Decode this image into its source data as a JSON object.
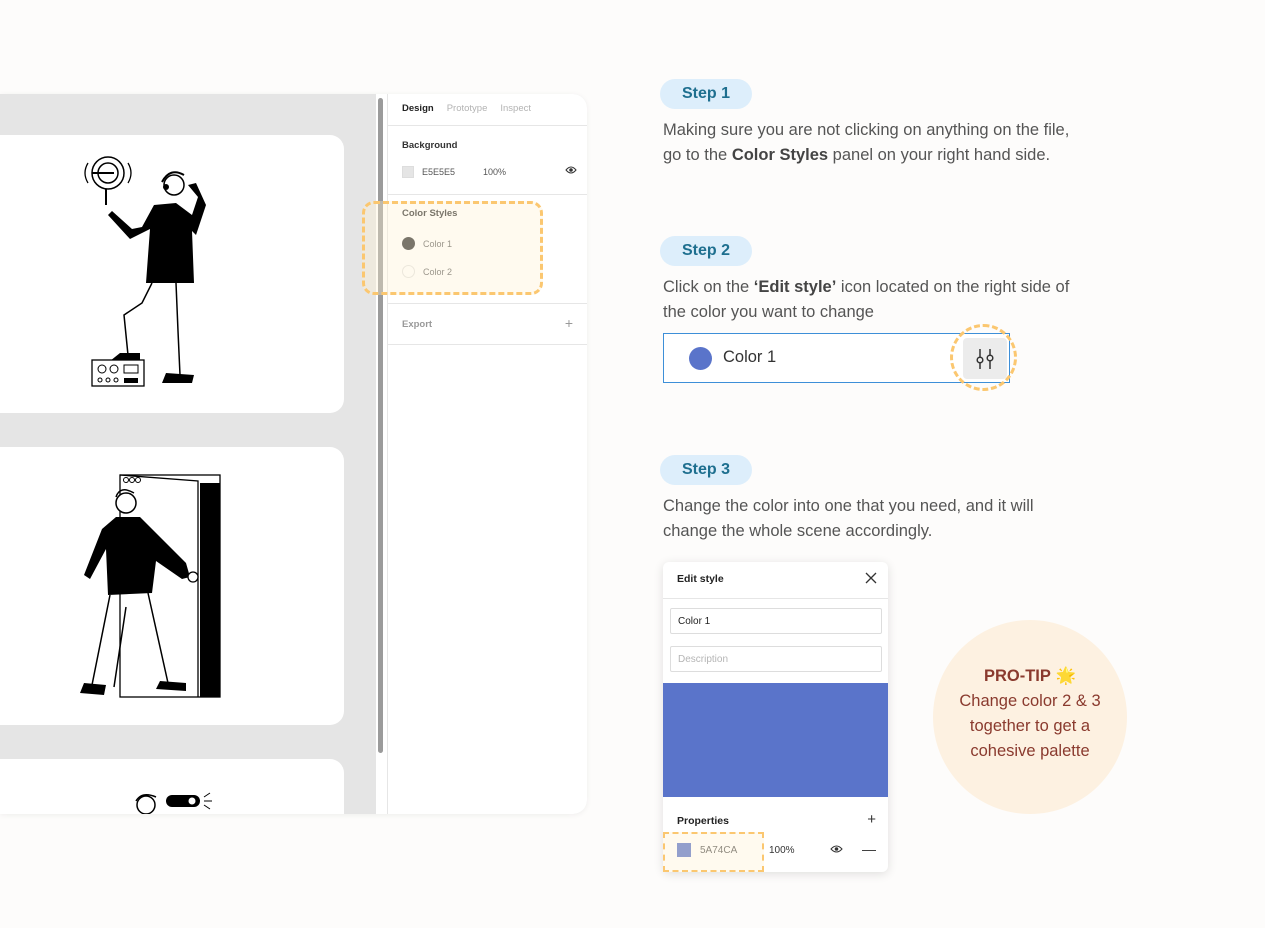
{
  "panel": {
    "tabs": [
      "Design",
      "Prototype",
      "Inspect"
    ],
    "background_title": "Background",
    "background_hex": "E5E5E5",
    "background_opacity": "100%",
    "color_styles_title": "Color Styles",
    "color_styles": [
      {
        "label": "Color 1",
        "color": "#333333"
      },
      {
        "label": "Color 2",
        "color": "#ffffff"
      }
    ],
    "export_title": "Export",
    "export_plus": "+"
  },
  "steps": [
    {
      "label": "Step 1"
    },
    {
      "label": "Step 2"
    },
    {
      "label": "Step 3"
    }
  ],
  "step1_text": {
    "a": "Making sure you are not clicking on anything on the file, go to the ",
    "b": "Color Styles",
    "c": " panel on your right hand side."
  },
  "step2_text": {
    "a": "Click on the ",
    "b": "‘Edit style’",
    "c": " icon located on the right side of the color you want to change"
  },
  "step3_text": "Change the color into one that you need, and it will change the whole scene accordingly.",
  "color_row": {
    "label": "Color 1",
    "color": "#5a74ca",
    "icon": "sliders-icon"
  },
  "edit_style": {
    "title": "Edit style",
    "name_value": "Color 1",
    "description_placeholder": "Description",
    "preview_color": "#5a74ca",
    "properties_title": "Properties",
    "properties_plus": "+",
    "hex": "5A74CA",
    "opacity": "100%",
    "minus": "—"
  },
  "protip": {
    "title": "PRO-TIP",
    "emoji": "🌟",
    "text": "Change color 2 & 3 together to get a cohesive palette"
  },
  "colors": {
    "accent": "#5a74ca",
    "highlight": "#fbc770",
    "pill_bg": "#ddeefb",
    "pill_text": "#1e6f8f",
    "protip_bg": "#fdf1e1",
    "protip_text": "#8a3a2e"
  }
}
